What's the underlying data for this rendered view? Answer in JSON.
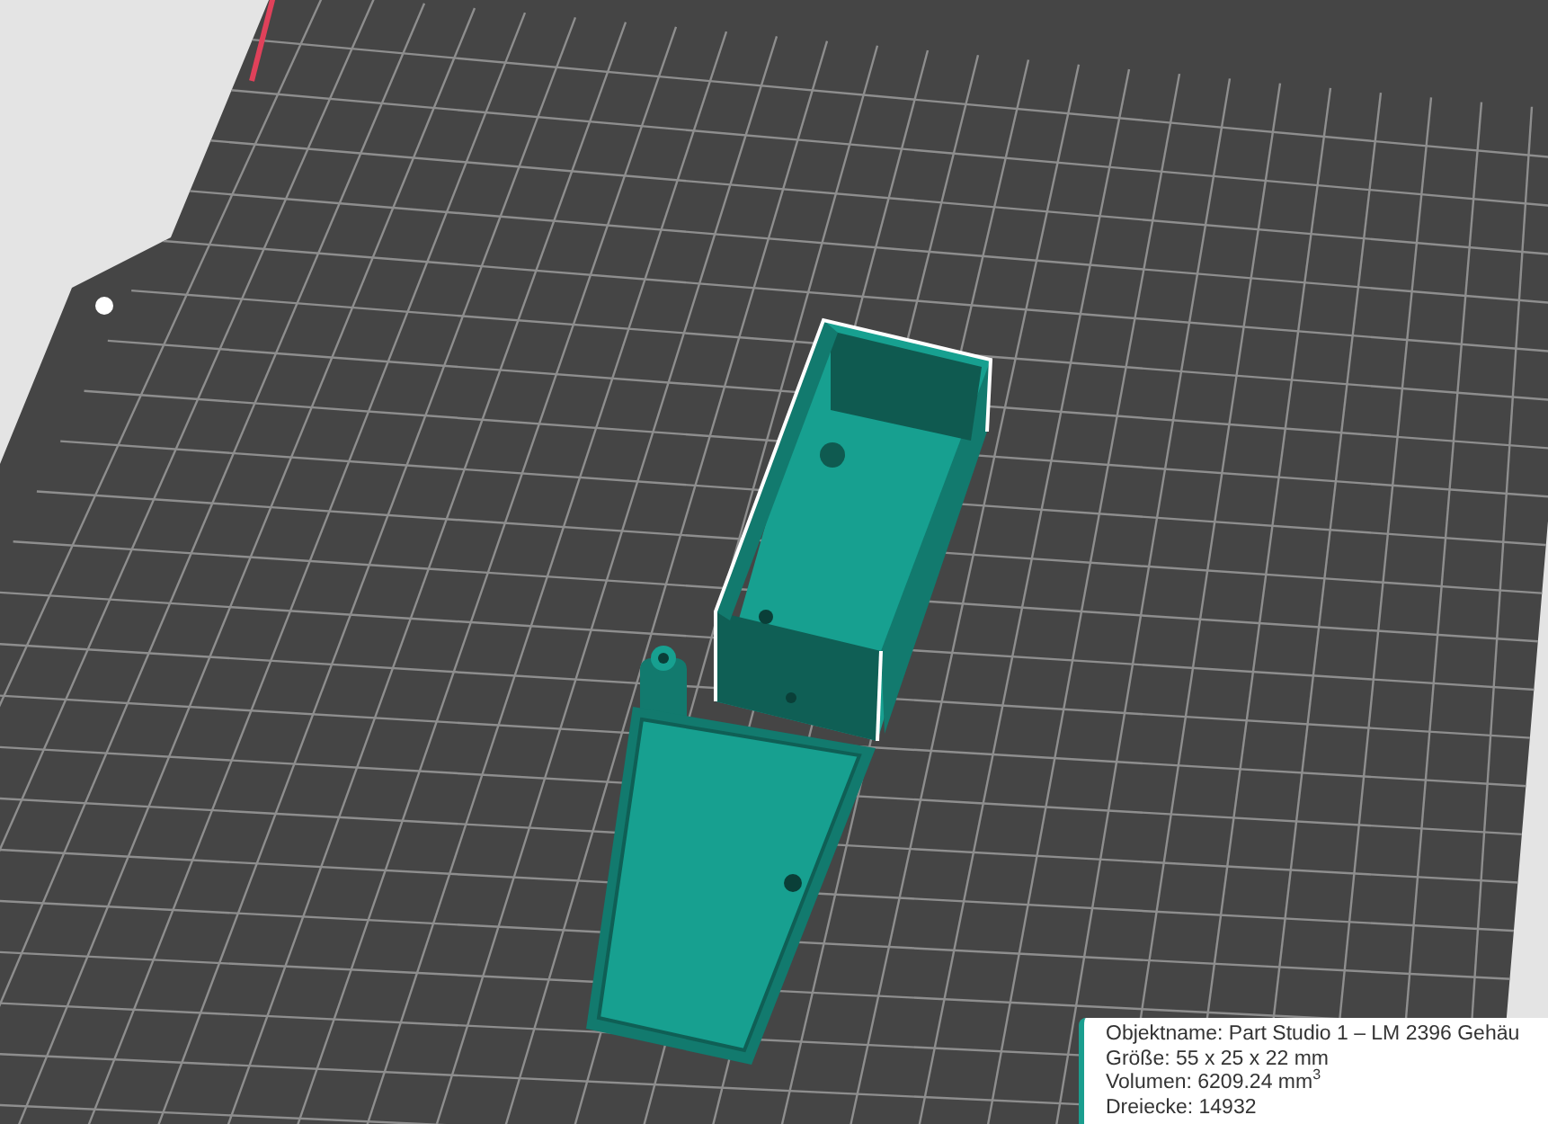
{
  "object_info": {
    "lines": [
      "Objektname: Part Studio 1 – LM 2396 Gehäu",
      "Größe: 55 x 25 x 22 mm",
      "Volumen: 6209.24 mm$^{3}$",
      "Dreiecke: 14932"
    ]
  }
}
